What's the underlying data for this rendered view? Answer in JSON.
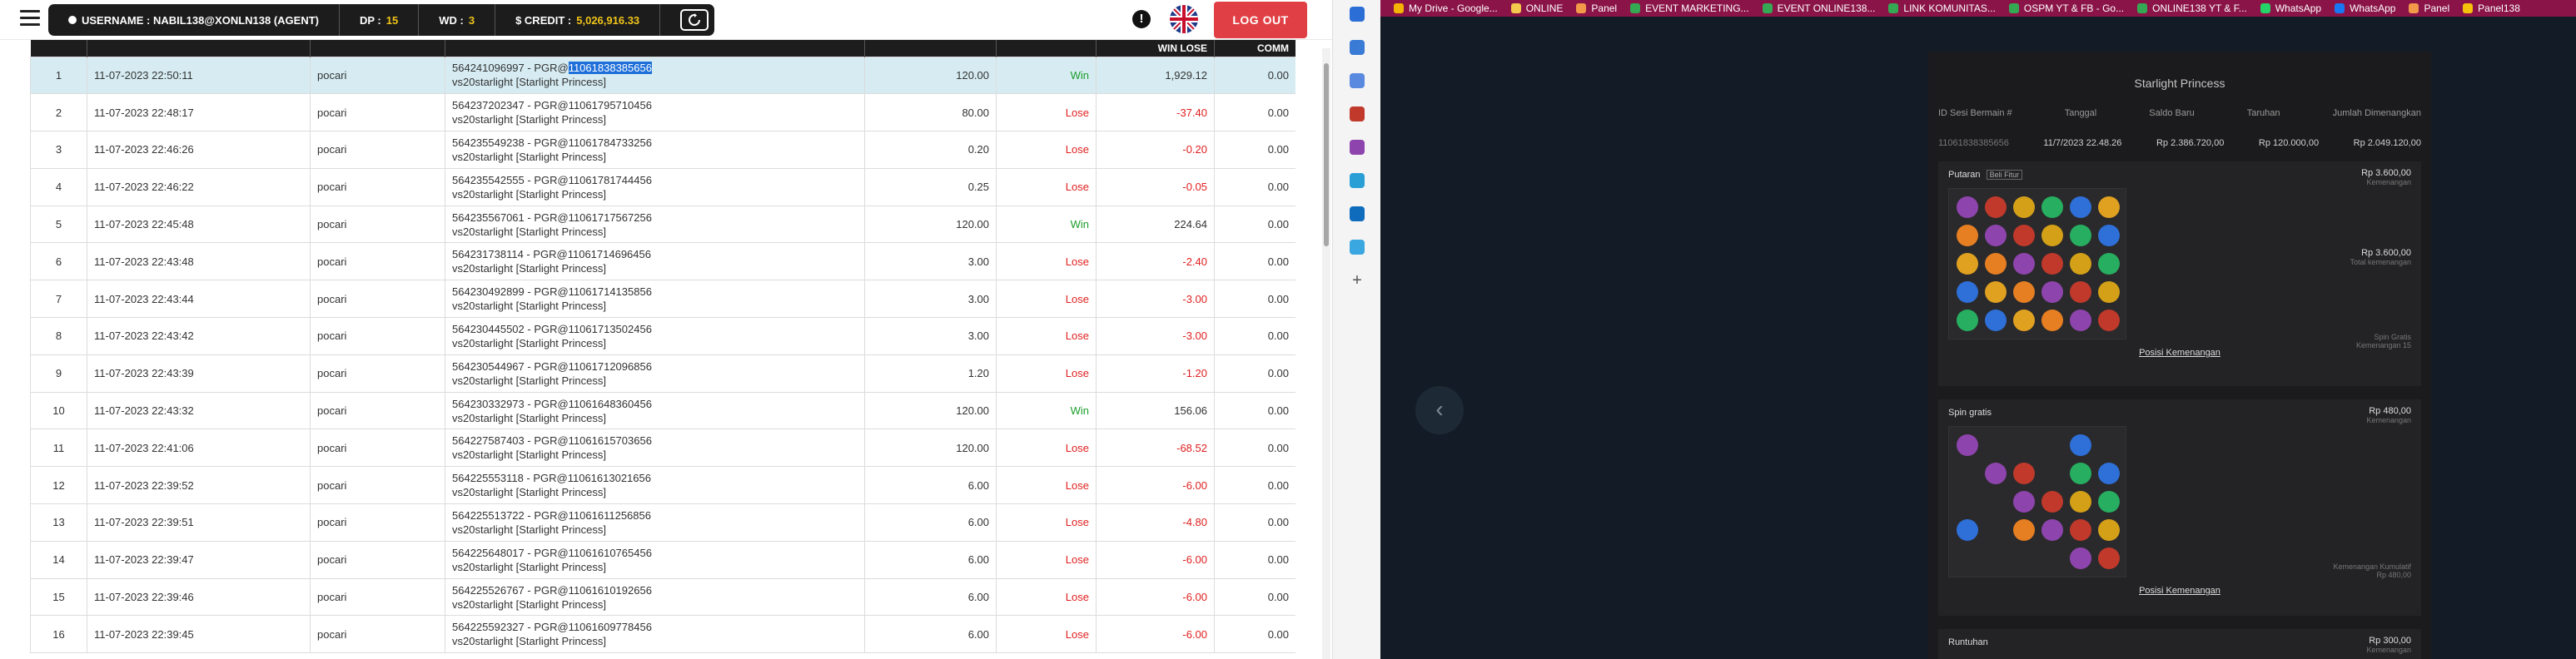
{
  "topbar": {
    "username_label": "USERNAME : NABIL138@XONLN138 (AGENT)",
    "dp_label": "DP :",
    "dp_value": "15",
    "wd_label": "WD :",
    "wd_value": "3",
    "credit_label": "$ CREDIT :",
    "credit_value": "5,026,916.33",
    "logout_label": "LOG OUT",
    "alert_glyph": "!"
  },
  "table": {
    "headers": [
      "",
      "",
      "",
      "",
      "",
      "",
      "WIN LOSE",
      "COMM"
    ],
    "rows": [
      {
        "no": "1",
        "date": "11-07-2023 22:50:11",
        "game": "pocari",
        "id": "564241096997 - PGR@",
        "id_hl": "11061838385656",
        "sub": "vs20starlight [Starlight Princess]",
        "amount": "120.00",
        "result": "Win",
        "wl": "1,929.12",
        "comm": "0.00"
      },
      {
        "no": "2",
        "date": "11-07-2023 22:48:17",
        "game": "pocari",
        "id": "564237202347 - PGR@11061795710456",
        "id_hl": "",
        "sub": "vs20starlight [Starlight Princess]",
        "amount": "80.00",
        "result": "Lose",
        "wl": "-37.40",
        "comm": "0.00"
      },
      {
        "no": "3",
        "date": "11-07-2023 22:46:26",
        "game": "pocari",
        "id": "564235549238 - PGR@11061784733256",
        "id_hl": "",
        "sub": "vs20starlight [Starlight Princess]",
        "amount": "0.20",
        "result": "Lose",
        "wl": "-0.20",
        "comm": "0.00"
      },
      {
        "no": "4",
        "date": "11-07-2023 22:46:22",
        "game": "pocari",
        "id": "564235542555 - PGR@11061781744456",
        "id_hl": "",
        "sub": "vs20starlight [Starlight Princess]",
        "amount": "0.25",
        "result": "Lose",
        "wl": "-0.05",
        "comm": "0.00"
      },
      {
        "no": "5",
        "date": "11-07-2023 22:45:48",
        "game": "pocari",
        "id": "564235567061 - PGR@11061717567256",
        "id_hl": "",
        "sub": "vs20starlight [Starlight Princess]",
        "amount": "120.00",
        "result": "Win",
        "wl": "224.64",
        "comm": "0.00"
      },
      {
        "no": "6",
        "date": "11-07-2023 22:43:48",
        "game": "pocari",
        "id": "564231738114 - PGR@11061714696456",
        "id_hl": "",
        "sub": "vs20starlight [Starlight Princess]",
        "amount": "3.00",
        "result": "Lose",
        "wl": "-2.40",
        "comm": "0.00"
      },
      {
        "no": "7",
        "date": "11-07-2023 22:43:44",
        "game": "pocari",
        "id": "564230492899 - PGR@11061714135856",
        "id_hl": "",
        "sub": "vs20starlight [Starlight Princess]",
        "amount": "3.00",
        "result": "Lose",
        "wl": "-3.00",
        "comm": "0.00"
      },
      {
        "no": "8",
        "date": "11-07-2023 22:43:42",
        "game": "pocari",
        "id": "564230445502 - PGR@11061713502456",
        "id_hl": "",
        "sub": "vs20starlight [Starlight Princess]",
        "amount": "3.00",
        "result": "Lose",
        "wl": "-3.00",
        "comm": "0.00"
      },
      {
        "no": "9",
        "date": "11-07-2023 22:43:39",
        "game": "pocari",
        "id": "564230544967 - PGR@11061712096856",
        "id_hl": "",
        "sub": "vs20starlight [Starlight Princess]",
        "amount": "1.20",
        "result": "Lose",
        "wl": "-1.20",
        "comm": "0.00"
      },
      {
        "no": "10",
        "date": "11-07-2023 22:43:32",
        "game": "pocari",
        "id": "564230332973 - PGR@11061648360456",
        "id_hl": "",
        "sub": "vs20starlight [Starlight Princess]",
        "amount": "120.00",
        "result": "Win",
        "wl": "156.06",
        "comm": "0.00"
      },
      {
        "no": "11",
        "date": "11-07-2023 22:41:06",
        "game": "pocari",
        "id": "564227587403 - PGR@11061615703656",
        "id_hl": "",
        "sub": "vs20starlight [Starlight Princess]",
        "amount": "120.00",
        "result": "Lose",
        "wl": "-68.52",
        "comm": "0.00"
      },
      {
        "no": "12",
        "date": "11-07-2023 22:39:52",
        "game": "pocari",
        "id": "564225553118 - PGR@11061613021656",
        "id_hl": "",
        "sub": "vs20starlight [Starlight Princess]",
        "amount": "6.00",
        "result": "Lose",
        "wl": "-6.00",
        "comm": "0.00"
      },
      {
        "no": "13",
        "date": "11-07-2023 22:39:51",
        "game": "pocari",
        "id": "564225513722 - PGR@11061611256856",
        "id_hl": "",
        "sub": "vs20starlight [Starlight Princess]",
        "amount": "6.00",
        "result": "Lose",
        "wl": "-4.80",
        "comm": "0.00"
      },
      {
        "no": "14",
        "date": "11-07-2023 22:39:47",
        "game": "pocari",
        "id": "564225648017 - PGR@11061610765456",
        "id_hl": "",
        "sub": "vs20starlight [Starlight Princess]",
        "amount": "6.00",
        "result": "Lose",
        "wl": "-6.00",
        "comm": "0.00"
      },
      {
        "no": "15",
        "date": "11-07-2023 22:39:46",
        "game": "pocari",
        "id": "564225526767 - PGR@11061610192656",
        "id_hl": "",
        "sub": "vs20starlight [Starlight Princess]",
        "amount": "6.00",
        "result": "Lose",
        "wl": "-6.00",
        "comm": "0.00"
      },
      {
        "no": "16",
        "date": "11-07-2023 22:39:45",
        "game": "pocari",
        "id": "564225592327 - PGR@11061609778456",
        "id_hl": "",
        "sub": "vs20starlight [Starlight Princess]",
        "amount": "6.00",
        "result": "Lose",
        "wl": "-6.00",
        "comm": "0.00"
      }
    ]
  },
  "bookmarks": [
    {
      "label": "My Drive - Google...",
      "color": "#f4b400"
    },
    {
      "label": "ONLINE",
      "color": "#f2c94c"
    },
    {
      "label": "Panel",
      "color": "#f2994a"
    },
    {
      "label": "EVENT MARKETING...",
      "color": "#34a853"
    },
    {
      "label": "EVENT ONLINE138...",
      "color": "#34a853"
    },
    {
      "label": "LINK KOMUNITAS...",
      "color": "#34a853"
    },
    {
      "label": "OSPM YT & FB - Go...",
      "color": "#34a853"
    },
    {
      "label": "ONLINE138 YT & F...",
      "color": "#34a853"
    },
    {
      "label": "WhatsApp",
      "color": "#25d366"
    },
    {
      "label": "WhatsApp",
      "color": "#1877f2"
    },
    {
      "label": "Panel",
      "color": "#f2994a"
    },
    {
      "label": "Panel138",
      "color": "#f4c20d"
    }
  ],
  "game": {
    "title": "Starlight Princess",
    "headers": [
      "ID Sesi Bermain #",
      "Tanggal",
      "Saldo Baru",
      "Taruhan",
      "Jumlah Dimenangkan"
    ],
    "row": [
      "11061838385656",
      "11/7/2023 22.48.26",
      "Rp 2.386.720,00",
      "Rp 120.000,00",
      "Rp 2.049.120,00"
    ],
    "section1_title": "Putaran",
    "section1_tag": "Beli Fitur",
    "section1_amt": "Rp 3.600,00",
    "section1_amt_sub": "Kemenangan",
    "section1_total": "Rp 3.600,00",
    "section1_total_sub": "Total kemenangan",
    "section1_spin": "Spin Gratis",
    "section1_spin_sub": "Kemenangan 15",
    "posisi_label": "Posisi Kemenangan",
    "section2_title": "Spin gratis",
    "section2_amt": "Rp 480,00",
    "section2_amt_sub": "Kemenangan",
    "section2_total_label": "Kemenangan Kumulatif",
    "section2_total": "Rp 480,00",
    "section3_title": "Runtuhan",
    "section3_amt": "Rp 300,00",
    "section3_amt_sub": "Kemenangan"
  }
}
